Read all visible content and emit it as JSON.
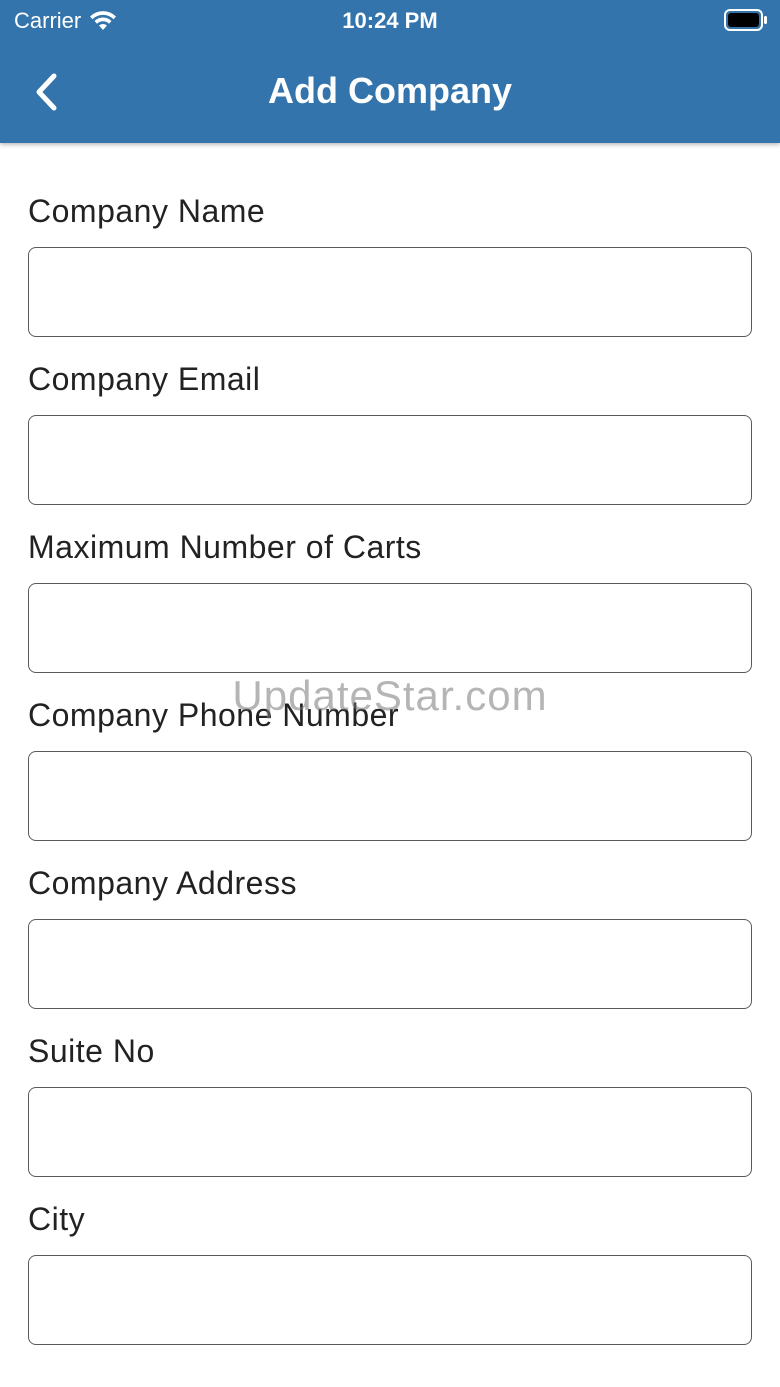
{
  "status_bar": {
    "carrier": "Carrier",
    "time": "10:24 PM"
  },
  "nav": {
    "title": "Add Company",
    "back_icon": "chevron-left-icon"
  },
  "form": {
    "fields": [
      {
        "label": "Company Name",
        "value": "",
        "placeholder": ""
      },
      {
        "label": "Company Email",
        "value": "",
        "placeholder": ""
      },
      {
        "label": "Maximum Number of Carts",
        "value": "",
        "placeholder": ""
      },
      {
        "label": "Company Phone Number",
        "value": "",
        "placeholder": ""
      },
      {
        "label": "Company Address",
        "value": "",
        "placeholder": ""
      },
      {
        "label": "Suite No",
        "value": "",
        "placeholder": ""
      },
      {
        "label": "City",
        "value": "",
        "placeholder": ""
      }
    ]
  },
  "watermark": "UpdateStar.com",
  "colors": {
    "header_bg": "#3274ab",
    "header_text": "#ffffff",
    "label_text": "#222222",
    "input_border": "#5a5a5a"
  }
}
